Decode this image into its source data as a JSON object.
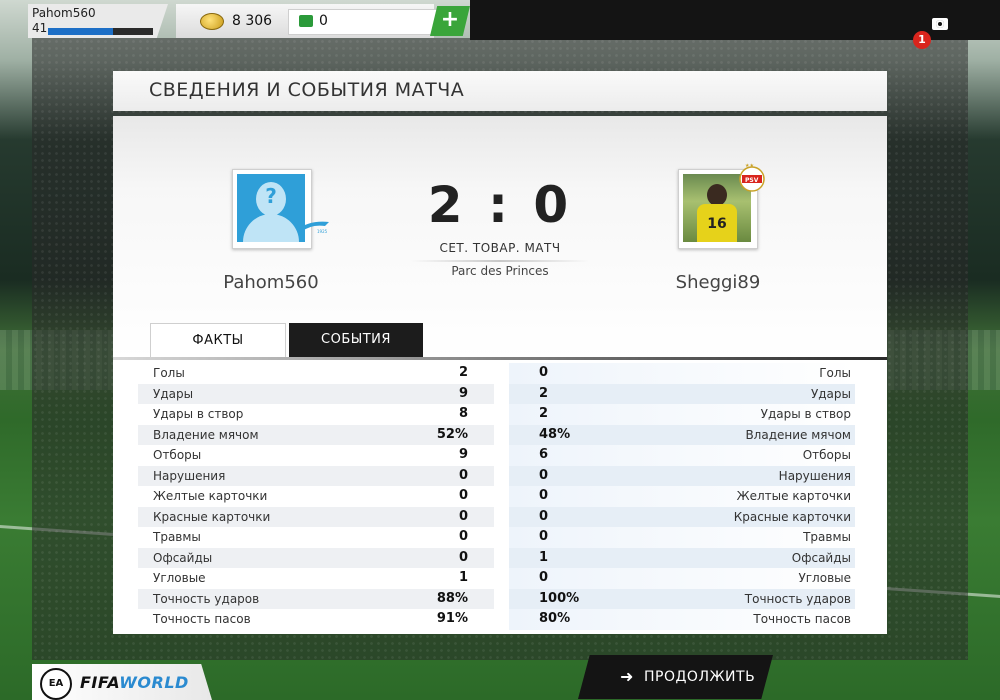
{
  "topbar": {
    "username": "Pahom560",
    "level": "41",
    "xp_progress": 0.62,
    "coins": "8 306",
    "cash": "0",
    "plus": "+",
    "notification_count": "1"
  },
  "title": "СВЕДЕНИЯ И СОБЫТИЯ МАТЧА",
  "match": {
    "home_name": "Pahom560",
    "away_name": "Sheggi89",
    "score": "2 : 0",
    "type": "СЕТ. ТОВАР. МАТЧ",
    "venue": "Parc des Princes",
    "away_player_number": "16"
  },
  "tabs": {
    "facts": "ФАКТЫ",
    "events": "СОБЫТИЯ"
  },
  "stats": [
    {
      "label": "Голы",
      "home": "2",
      "away": "0"
    },
    {
      "label": "Удары",
      "home": "9",
      "away": "2"
    },
    {
      "label": "Удары в створ",
      "home": "8",
      "away": "2"
    },
    {
      "label": "Владение мячом",
      "home": "52%",
      "away": "48%"
    },
    {
      "label": "Отборы",
      "home": "9",
      "away": "6"
    },
    {
      "label": "Нарушения",
      "home": "0",
      "away": "0"
    },
    {
      "label": "Желтые карточки",
      "home": "0",
      "away": "0"
    },
    {
      "label": "Красные карточки",
      "home": "0",
      "away": "0"
    },
    {
      "label": "Травмы",
      "home": "0",
      "away": "0"
    },
    {
      "label": "Офсайды",
      "home": "0",
      "away": "1"
    },
    {
      "label": "Угловые",
      "home": "1",
      "away": "0"
    },
    {
      "label": "Точность ударов",
      "home": "88%",
      "away": "100%"
    },
    {
      "label": "Точность пасов",
      "home": "91%",
      "away": "80%"
    }
  ],
  "footer": {
    "ea_logo": "EA",
    "fifa_text_a": "FIFA",
    "fifa_text_b": "WORLD",
    "continue_label": "ПРОДОЛЖИТЬ",
    "continue_arrow": "➜"
  },
  "colors": {
    "accent_green": "#3aa53a",
    "xp_blue": "#1d6fc6",
    "notification_red": "#d9251d"
  }
}
